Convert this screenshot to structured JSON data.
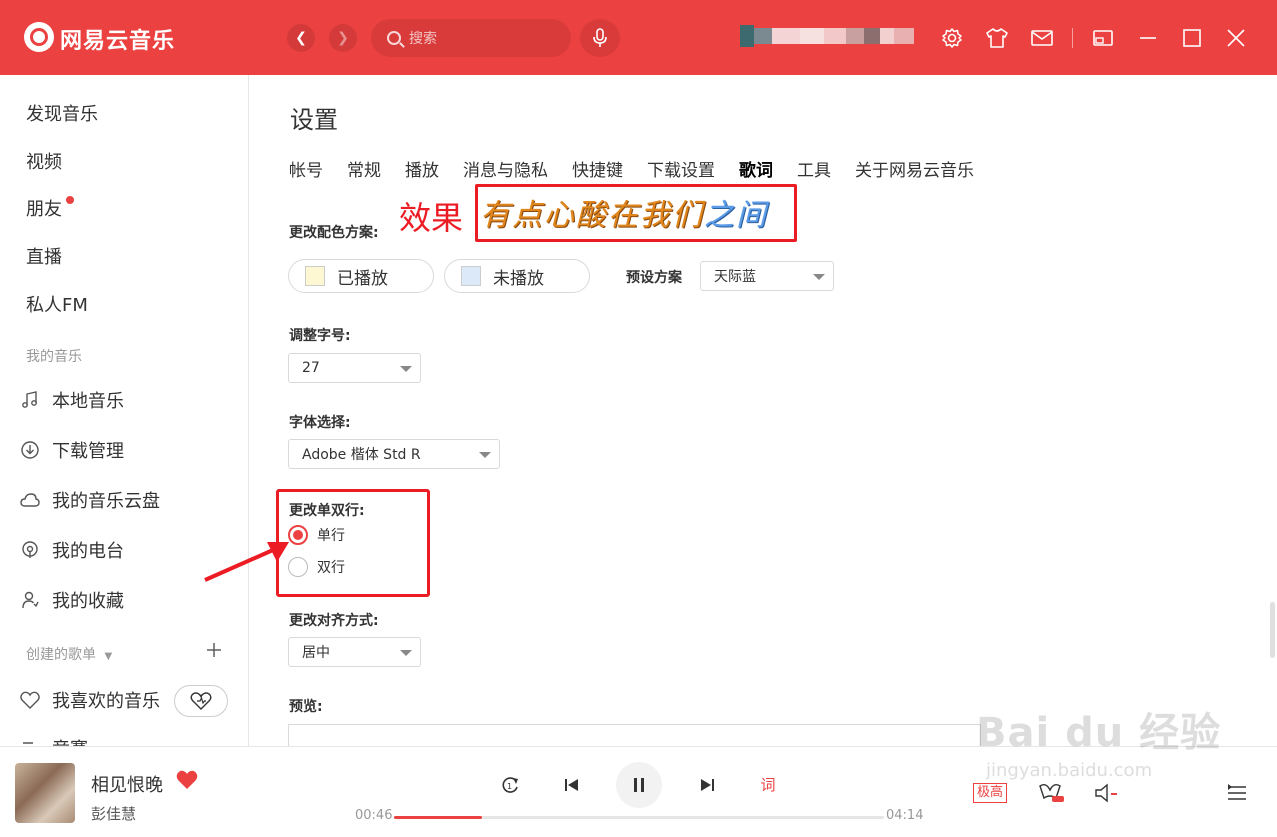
{
  "app": {
    "name": "网易云音乐"
  },
  "header": {
    "search_placeholder": "搜索"
  },
  "sidebar": {
    "discover": "发现音乐",
    "video": "视频",
    "friends": "朋友",
    "live": "直播",
    "fm": "私人FM",
    "my_music_heading": "我的音乐",
    "local_music": "本地音乐",
    "downloads": "下载管理",
    "cloud": "我的音乐云盘",
    "radio": "我的电台",
    "favorites": "我的收藏",
    "created_playlists": "创建的歌单",
    "liked_music": "我喜欢的音乐",
    "partial_item": "竞赛"
  },
  "settings": {
    "title": "设置",
    "tabs": [
      "帐号",
      "常规",
      "播放",
      "消息与隐私",
      "快捷键",
      "下载设置",
      "歌词",
      "工具",
      "关于网易云音乐"
    ],
    "active_tab": "歌词",
    "color_scheme_label": "更改配色方案:",
    "played_label": "已播放",
    "unplayed_label": "未播放",
    "preset_label": "预设方案",
    "preset_value": "天际蓝",
    "font_size_label": "调整字号:",
    "font_size_value": "27",
    "font_label": "字体选择:",
    "font_value": "Adobe 楷体 Std R",
    "lines_label": "更改单双行:",
    "single_line": "单行",
    "double_line": "双行",
    "align_label": "更改对齐方式:",
    "align_value": "居中",
    "preview_label": "预览:"
  },
  "annotation": {
    "effect_label": "效果",
    "effect_sample_main": "有点心酸在我们",
    "effect_sample_end": "之间"
  },
  "player": {
    "song": "相见恨晚",
    "artist": "彭佳慧",
    "current_time": "00:46",
    "total_time": "04:14",
    "progress": 0.18,
    "lyric_icon": "词",
    "quality": "极高"
  },
  "watermark": {
    "brand": "Bai du 经验",
    "url": "jingyan.baidu.com"
  },
  "colors": {
    "accent": "#ec4141",
    "annotation": "#ec1c24"
  },
  "icons": [
    "logo-icon",
    "back-icon",
    "forward-icon",
    "search-icon",
    "mic-icon",
    "settings-icon",
    "skin-icon",
    "mail-icon",
    "mini-mode-icon",
    "minimize-icon",
    "maximize-icon",
    "close-icon",
    "music-note-icon",
    "download-icon",
    "cloud-icon",
    "radio-icon",
    "collection-icon",
    "plus-icon",
    "heart-icon",
    "heart-mode-icon",
    "loop-icon",
    "prev-icon",
    "pause-icon",
    "next-icon",
    "lyric-icon",
    "sound-effect-icon",
    "volume-icon",
    "playlist-icon"
  ]
}
